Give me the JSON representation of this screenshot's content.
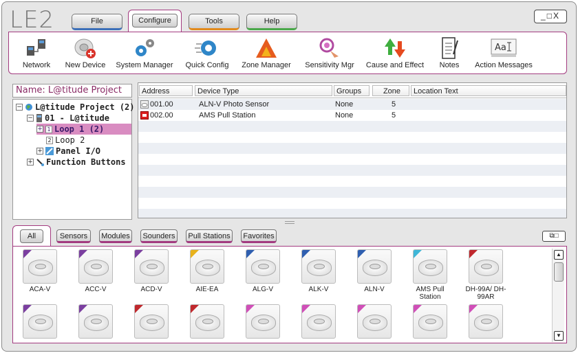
{
  "app": {
    "logo": "LE2",
    "window_controls": "_□X",
    "restore_controls": "⧉□"
  },
  "menu": {
    "file": "File",
    "configure": "Configure",
    "tools": "Tools",
    "help": "Help"
  },
  "toolbar": [
    {
      "label": "Network",
      "icon": "network-icon"
    },
    {
      "label": "New Device",
      "icon": "new-device-icon"
    },
    {
      "label": "System Manager",
      "icon": "system-manager-icon"
    },
    {
      "label": "Quick Config",
      "icon": "quick-config-icon"
    },
    {
      "label": "Zone Manager",
      "icon": "zone-manager-icon"
    },
    {
      "label": "Sensitivity Mgr",
      "icon": "sensitivity-icon"
    },
    {
      "label": "Cause and Effect",
      "icon": "cause-effect-icon"
    },
    {
      "label": "Notes",
      "icon": "notes-icon"
    },
    {
      "label": "Action Messages",
      "icon": "action-messages-icon"
    }
  ],
  "project": {
    "name_label": "Name: L@titude Project"
  },
  "tree": [
    {
      "label": "L@titude Project (2)",
      "expander": "−",
      "bold": true
    },
    {
      "label": "01 - L@titude",
      "expander": "−",
      "bold": true
    },
    {
      "label": "Loop 1 (2)",
      "expander": "+",
      "num": "1",
      "bold": true,
      "selected": true
    },
    {
      "label": "Loop 2",
      "expander": "",
      "num": "2",
      "bold": false
    },
    {
      "label": "Panel I/O",
      "expander": "+",
      "bold": true
    },
    {
      "label": "Function Buttons",
      "expander": "+",
      "bold": true
    }
  ],
  "grid": {
    "headers": [
      "Address",
      "Device Type",
      "Groups",
      "Zone",
      "Location Text"
    ],
    "rows": [
      {
        "address": "001.00",
        "type": "ALN-V Photo Sensor",
        "groups": "None",
        "zone": "5",
        "location": ""
      },
      {
        "address": "002.00",
        "type": "AMS Pull Station",
        "groups": "None",
        "zone": "5",
        "location": ""
      }
    ]
  },
  "palette_tabs": [
    "All",
    "Sensors",
    "Modules",
    "Sounders",
    "Pull Stations",
    "Favorites"
  ],
  "devices_row1": [
    {
      "label": "ACA-V",
      "corner": "#7b3fa0"
    },
    {
      "label": "ACC-V",
      "corner": "#7b3fa0"
    },
    {
      "label": "ACD-V",
      "corner": "#7b3fa0"
    },
    {
      "label": "AIE-EA",
      "corner": "#e8b21b"
    },
    {
      "label": "ALG-V",
      "corner": "#2f5fb0"
    },
    {
      "label": "ALK-V",
      "corner": "#2f5fb0"
    },
    {
      "label": "ALN-V",
      "corner": "#2f5fb0"
    },
    {
      "label": "AMS Pull Station",
      "corner": "#3fb7d8"
    },
    {
      "label": "DH-99A/ DH-99AR",
      "corner": "#c0282d"
    }
  ],
  "devices_row2": [
    {
      "corner": "#7b3fa0"
    },
    {
      "corner": "#7b3fa0"
    },
    {
      "corner": "#c0282d"
    },
    {
      "corner": "#c0282d"
    },
    {
      "corner": "#d04fb8"
    },
    {
      "corner": "#d04fb8"
    },
    {
      "corner": "#d04fb8"
    },
    {
      "corner": "#d04fb8"
    },
    {
      "corner": "#d04fb8"
    }
  ]
}
